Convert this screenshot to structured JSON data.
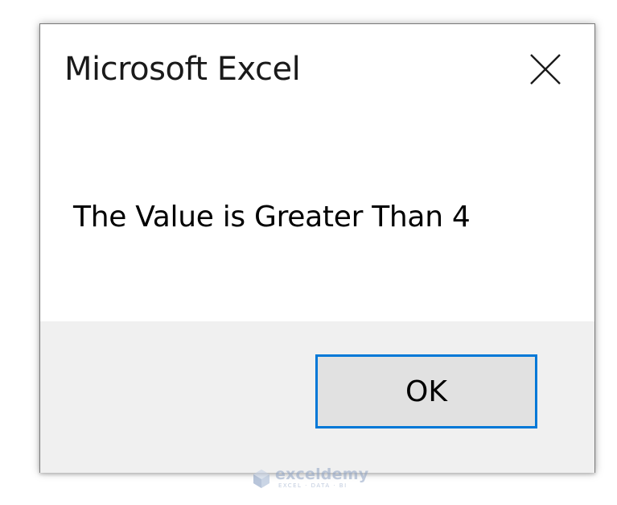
{
  "dialog": {
    "title": "Microsoft Excel",
    "message": "The Value is Greater Than 4",
    "ok_label": "OK",
    "close_icon": "close-icon"
  },
  "watermark": {
    "name": "exceldemy",
    "tagline": "EXCEL · DATA · BI",
    "logo_icon": "exceldemy-logo-icon"
  },
  "colors": {
    "dialog_background": "#ffffff",
    "footer_background": "#f0f0f0",
    "button_background": "#e1e1e1",
    "button_focus_border": "#0078d7"
  }
}
